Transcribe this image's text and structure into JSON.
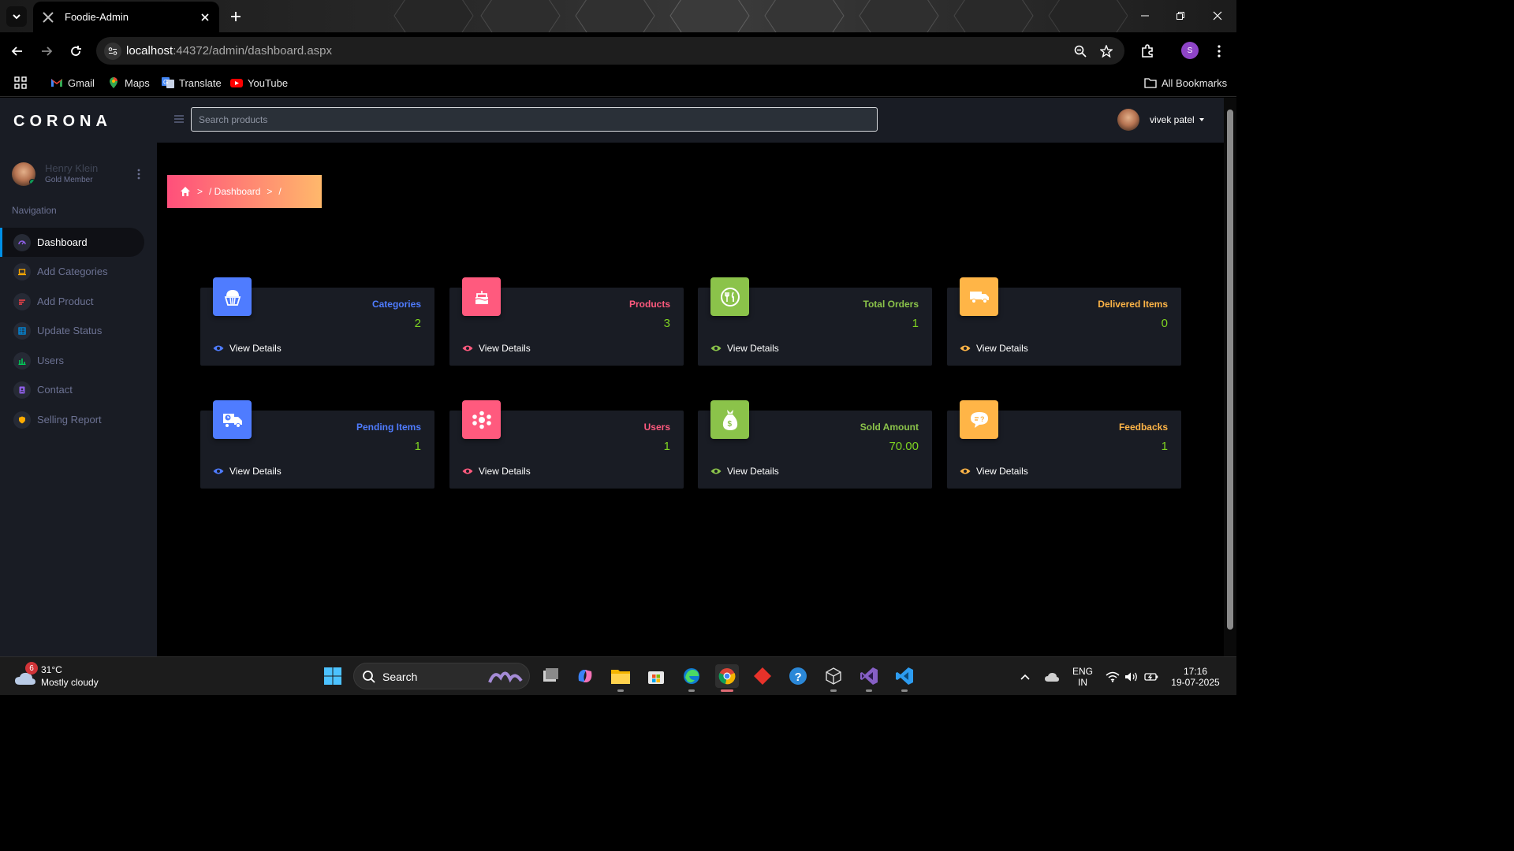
{
  "browser": {
    "tab_title": "Foodie-Admin",
    "url_host": "localhost",
    "url_path": ":44372/admin/dashboard.aspx",
    "profile_initial": "S",
    "bookmarks": [
      "Gmail",
      "Maps",
      "Translate",
      "YouTube"
    ],
    "all_bookmarks": "All Bookmarks"
  },
  "sidebar": {
    "brand": "CORONA",
    "profile_name": "Henry Klein",
    "profile_rank": "Gold Member",
    "nav_heading": "Navigation",
    "items": [
      {
        "label": "Dashboard",
        "icon": "speedometer-icon",
        "color": "#8f5fe8"
      },
      {
        "label": "Add Categories",
        "icon": "laptop-icon",
        "color": "#ffab00"
      },
      {
        "label": "Add Product",
        "icon": "playlist-icon",
        "color": "#fc424a"
      },
      {
        "label": "Update Status",
        "icon": "table-icon",
        "color": "#0090e7"
      },
      {
        "label": "Users",
        "icon": "chart-bar-icon",
        "color": "#00d25b"
      },
      {
        "label": "Contact",
        "icon": "contacts-icon",
        "color": "#8f5fe8"
      },
      {
        "label": "Selling Report",
        "icon": "shield-icon",
        "color": "#ffab00"
      }
    ]
  },
  "topbar": {
    "search_placeholder": "Search products",
    "user_name": "vivek patel"
  },
  "breadcrumb": {
    "separator1": ">",
    "page": "/  Dashboard",
    "separator2": ">",
    "trail": "/"
  },
  "cards": [
    {
      "title": "Categories",
      "value": "2",
      "link": "View Details",
      "color": "#4f7cff",
      "icon": "cupcake-icon"
    },
    {
      "title": "Products",
      "value": "3",
      "link": "View Details",
      "color": "#ff5a7e",
      "icon": "cake-icon"
    },
    {
      "title": "Total Orders",
      "value": "1",
      "link": "View Details",
      "color": "#8bc34a",
      "icon": "restaurant-icon"
    },
    {
      "title": "Delivered Items",
      "value": "0",
      "link": "View Details",
      "color": "#ffb547",
      "icon": "delivery-truck-icon"
    },
    {
      "title": "Pending Items",
      "value": "1",
      "link": "View Details",
      "color": "#4f7cff",
      "icon": "loading-truck-icon"
    },
    {
      "title": "Users",
      "value": "1",
      "link": "View Details",
      "color": "#ff5a7e",
      "icon": "users-group-icon"
    },
    {
      "title": "Sold Amount",
      "value": "70.00",
      "link": "View Details",
      "color": "#8bc34a",
      "icon": "money-bag-icon"
    },
    {
      "title": "Feedbacks",
      "value": "1",
      "link": "View Details",
      "color": "#ffb547",
      "icon": "feedback-bubble-icon"
    }
  ],
  "taskbar": {
    "weather_badge": "6",
    "temperature": "31°C",
    "condition": "Mostly cloudy",
    "search_label": "Search",
    "language": "ENG",
    "region": "IN",
    "time": "17:16",
    "date": "19-07-2025"
  }
}
